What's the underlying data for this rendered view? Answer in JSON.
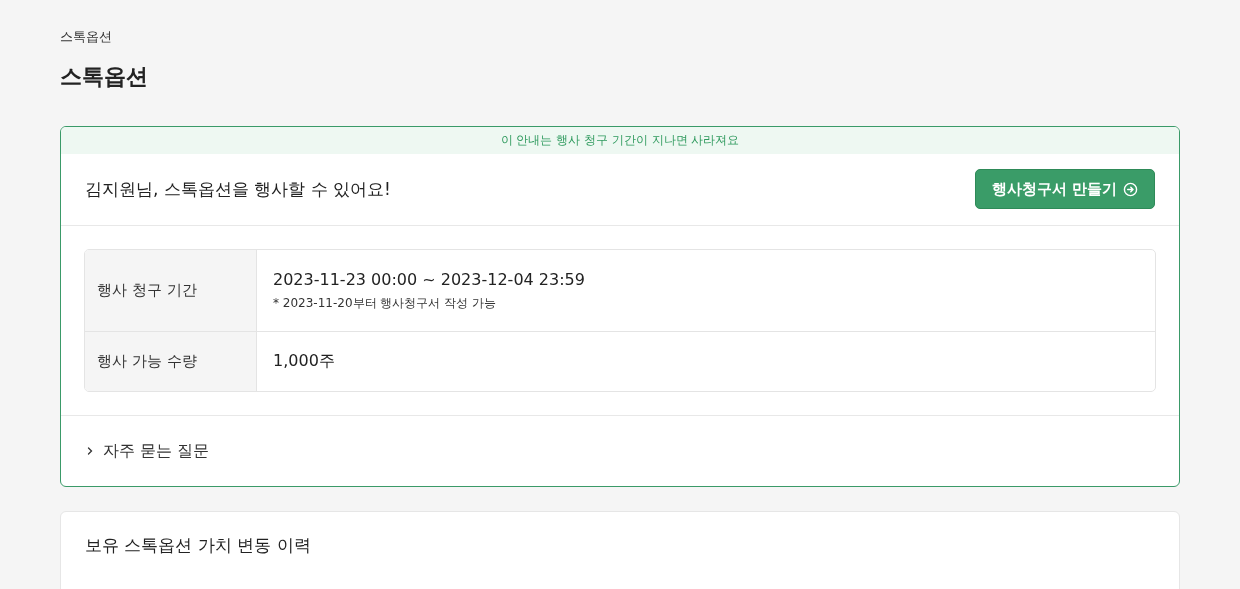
{
  "breadcrumb": "스톡옵션",
  "page_title": "스톡옵션",
  "notice_card": {
    "banner": "이 안내는 행사 청구 기간이 지나면 사라져요",
    "message": "김지원님, 스톡옵션을 행사할 수 있어요!",
    "button": {
      "label": "행사청구서 만들기"
    },
    "rows": [
      {
        "label": "행사 청구 기간",
        "value": "2023-11-23 00:00 ~ 2023-12-04 23:59",
        "note": "* 2023-11-20부터 행사청구서 작성 가능"
      },
      {
        "label": "행사 가능 수량",
        "value": "1,000주"
      }
    ],
    "faq": {
      "label": "자주 묻는 질문",
      "expanded": false
    }
  },
  "history_card": {
    "title": "보유 스톡옵션 가치 변동 이력"
  }
}
